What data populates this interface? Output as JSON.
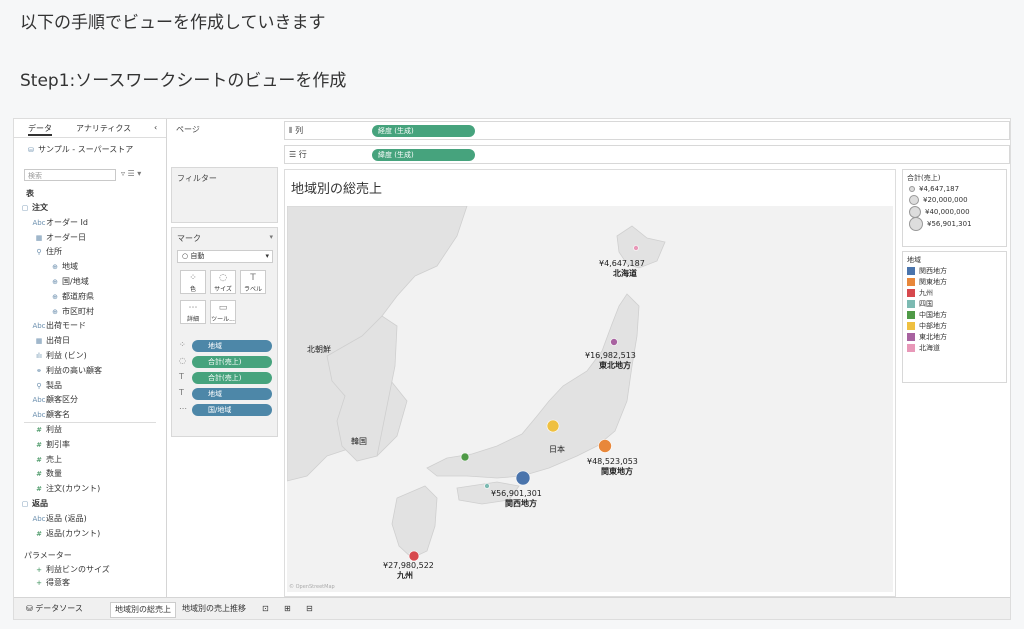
{
  "article": {
    "line1": "以下の手順でビューを作成していきます",
    "line2": "Step1:ソースワークシートのビューを作成"
  },
  "datapane": {
    "tab_data": "データ",
    "tab_analytics": "アナリティクス",
    "collapse": "‹",
    "datasource": "サンプル - スーパーストア",
    "search_placeholder": "検索",
    "section_tables": "表",
    "fields": [
      {
        "icon": "▢",
        "label": "注文",
        "bold": true
      },
      {
        "icon": "Abc",
        "label": "オーダー Id"
      },
      {
        "icon": "▦",
        "label": "オーダー日"
      },
      {
        "icon": "⚲",
        "label": "住所"
      },
      {
        "icon": "⊕",
        "label": "地域"
      },
      {
        "icon": "⊕",
        "label": "国/地域"
      },
      {
        "icon": "⊕",
        "label": "都道府県"
      },
      {
        "icon": "⊕",
        "label": "市区町村"
      },
      {
        "icon": "Abc",
        "label": "出荷モード"
      },
      {
        "icon": "▦",
        "label": "出荷日"
      },
      {
        "icon": "ılı",
        "label": "利益 (ビン)"
      },
      {
        "icon": "⚭",
        "label": "利益の高い顧客"
      },
      {
        "icon": "⚲",
        "label": "製品"
      },
      {
        "icon": "Abc",
        "label": "顧客区分"
      },
      {
        "icon": "Abc",
        "label": "顧客名"
      },
      {
        "icon": "#",
        "label": "利益",
        "measure": true
      },
      {
        "icon": "#",
        "label": "割引率",
        "measure": true
      },
      {
        "icon": "#",
        "label": "売上",
        "measure": true
      },
      {
        "icon": "#",
        "label": "数量",
        "measure": true
      },
      {
        "icon": "#",
        "label": "注文(カウント)",
        "measure": true
      },
      {
        "icon": "▢",
        "label": "返品",
        "bold": true
      },
      {
        "icon": "Abc",
        "label": "返品 (返品)"
      },
      {
        "icon": "#",
        "label": "返品(カウント)",
        "measure": true
      }
    ],
    "params_header": "パラメーター",
    "params": [
      {
        "icon": "+",
        "label": "利益ビンのサイズ"
      },
      {
        "icon": "+",
        "label": "得意客"
      }
    ]
  },
  "pages_label": "ページ",
  "filters_label": "フィルター",
  "marks": {
    "label": "マーク",
    "type": "自動",
    "buttons": [
      {
        "icon": "⁘",
        "label": "色"
      },
      {
        "icon": "◌",
        "label": "サイズ"
      },
      {
        "icon": "T",
        "label": "ラベル"
      },
      {
        "icon": "⋯",
        "label": "詳細"
      },
      {
        "icon": "▭",
        "label": "ツール..."
      }
    ],
    "pills": [
      {
        "icon": "⁘",
        "label": "地域",
        "color": "blue"
      },
      {
        "icon": "◌",
        "label": "合計(売上)",
        "color": "green"
      },
      {
        "icon": "T",
        "label": "合計(売上)",
        "color": "green"
      },
      {
        "icon": "T",
        "label": "地域",
        "color": "blue"
      },
      {
        "icon": "⋯",
        "label": "国/地域",
        "color": "blue"
      }
    ]
  },
  "shelves": {
    "columns_label": "列",
    "columns_pill": "経度 (生成)",
    "rows_label": "行",
    "rows_pill": "緯度 (生成)"
  },
  "view_title": "地域別の総売上",
  "map_labels": {
    "north_korea": "北朝鮮",
    "korea": "韓国",
    "japan": "日本"
  },
  "map_points": [
    {
      "region": "北海道",
      "value": "¥4,647,187",
      "color": "#e898b8"
    },
    {
      "region": "東北地方",
      "value": "¥16,982,513",
      "color": "#a862a0"
    },
    {
      "region": "関東地方",
      "value": "¥48,523,053",
      "color": "#e8873a"
    },
    {
      "region": "関西地方",
      "value": "¥56,901,301",
      "color": "#4a74ac"
    },
    {
      "region": "九州",
      "value": "¥27,980,522",
      "color": "#d7484d"
    },
    {
      "region": "中部地方",
      "value": "",
      "color": "#efc040"
    },
    {
      "region": "中国地方",
      "value": "",
      "color": "#4f9a47"
    },
    {
      "region": "四国",
      "value": "",
      "color": "#7cbab2"
    }
  ],
  "size_legend": {
    "title": "合計(売上)",
    "items": [
      "¥4,647,187",
      "¥20,000,000",
      "¥40,000,000",
      "¥56,901,301"
    ]
  },
  "color_legend": {
    "title": "地域",
    "items": [
      {
        "label": "関西地方",
        "color": "#4a74ac"
      },
      {
        "label": "関東地方",
        "color": "#e8873a"
      },
      {
        "label": "九州",
        "color": "#d7484d"
      },
      {
        "label": "四国",
        "color": "#7cbab2"
      },
      {
        "label": "中国地方",
        "color": "#4f9a47"
      },
      {
        "label": "中部地方",
        "color": "#efc040"
      },
      {
        "label": "東北地方",
        "color": "#a862a0"
      },
      {
        "label": "北海道",
        "color": "#e898b8"
      }
    ]
  },
  "bottom_tabs": {
    "datasource": "データソース",
    "sheet1": "地域別の総売上",
    "sheet2": "地域別の売上推移"
  },
  "icons": {
    "datasource": "cylinder-icon",
    "new_sheet": "new-sheet-icon",
    "new_dashboard": "new-dashboard-icon",
    "new_story": "new-story-icon"
  }
}
